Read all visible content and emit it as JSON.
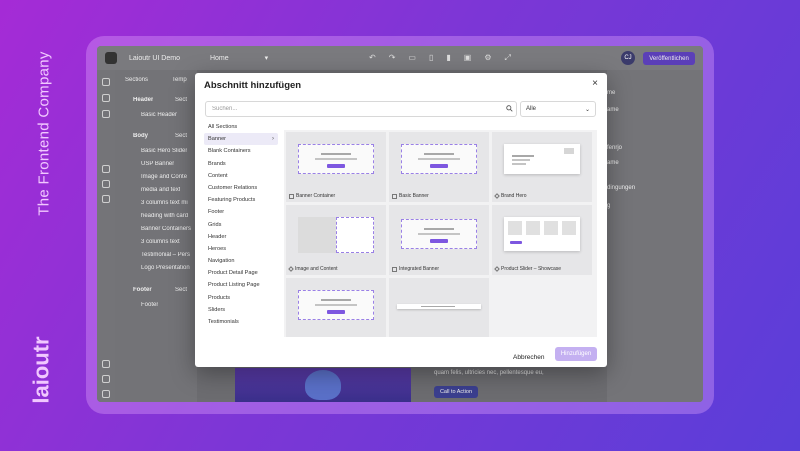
{
  "brand": {
    "tagline": "The Frontend Company",
    "wordmark": "laioutr"
  },
  "app": {
    "project": "Laioutr UI Demo",
    "page_select": "Home",
    "user_initials": "CJ",
    "publish_label": "Veröffentlichen",
    "icons": [
      "undo-icon",
      "redo-icon",
      "desktop-icon",
      "tablet-icon",
      "mobile-icon",
      "monitor-icon",
      "settings-icon",
      "fullscreen-icon"
    ],
    "tree": {
      "tab_sections": "Sections",
      "tab_templates": "Temp",
      "header": "Header",
      "header_add": "Sect",
      "header_items": [
        "Basic Header"
      ],
      "body": "Body",
      "body_add": "Sect",
      "body_items": [
        "Basic Hero Slider",
        "USP Banner",
        "Image and Conte",
        "media and text",
        "3 columns text mi",
        "heading with card",
        "Banner Containers",
        "3 columns text",
        "Testimonial – Pers",
        "Logo Presentation"
      ],
      "footer": "Footer",
      "footer_add": "Sect",
      "footer_items": [
        "Footer"
      ]
    },
    "right_panel": [
      "me",
      "ame",
      "fenrjo",
      "ame",
      "dingungen",
      "g"
    ],
    "canvas_text": "quam felis, ultricies nec, pellentesque eu,",
    "cta_label": "Call to Action"
  },
  "modal": {
    "title": "Abschnitt hinzufügen",
    "close": "×",
    "search_placeholder": "Suchen...",
    "filter_value": "Alle",
    "categories": [
      "All Sections",
      "Banner",
      "Blank Containers",
      "Brands",
      "Content",
      "Customer Relations",
      "Featuring Products",
      "Footer",
      "Grids",
      "Header",
      "Heroes",
      "Navigation",
      "Product Detail Page",
      "Product Listing Page",
      "Products",
      "Sliders",
      "Testimonials"
    ],
    "active_category": "Banner",
    "cards": [
      {
        "label": "Banner Container"
      },
      {
        "label": "Basic Banner"
      },
      {
        "label": "Brand Hero"
      },
      {
        "label": "Image and Content"
      },
      {
        "label": "Integrated Banner"
      },
      {
        "label": "Product Slider – Showcase"
      },
      {
        "label": ""
      },
      {
        "label": ""
      }
    ],
    "cancel_label": "Abbrechen",
    "add_label": "Hinzufügen",
    "accent": "#7d57e0"
  }
}
